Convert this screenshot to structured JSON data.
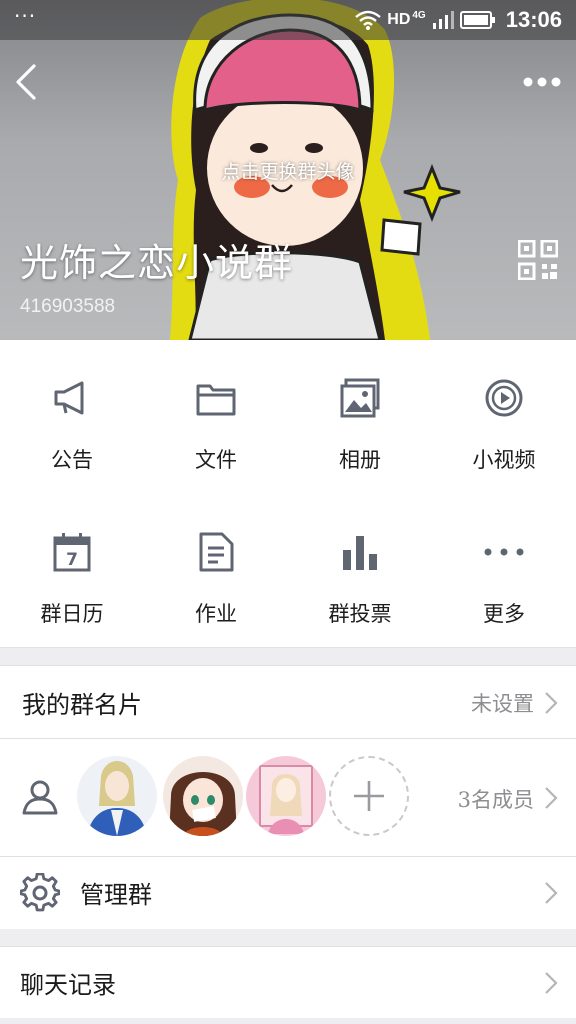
{
  "status_bar": {
    "left_dots": "···",
    "network": "HD",
    "net_gen": "4G",
    "time": "13:06"
  },
  "header": {
    "change_avatar_hint": "点击更换群头像",
    "group_name": "光饰之恋小说群",
    "group_id": "416903588"
  },
  "features": [
    {
      "label": "公告",
      "icon": "megaphone-icon"
    },
    {
      "label": "文件",
      "icon": "folder-icon"
    },
    {
      "label": "相册",
      "icon": "photo-album-icon"
    },
    {
      "label": "小视频",
      "icon": "video-play-icon"
    },
    {
      "label": "群日历",
      "icon": "calendar-icon",
      "icon_text": "7"
    },
    {
      "label": "作业",
      "icon": "document-icon"
    },
    {
      "label": "群投票",
      "icon": "bar-chart-icon"
    },
    {
      "label": "更多",
      "icon": "more-icon"
    }
  ],
  "my_card": {
    "label": "我的群名片",
    "value": "未设置"
  },
  "members": {
    "count_label": "3名成员"
  },
  "manage": {
    "label": "管理群"
  },
  "chat_history": {
    "label": "聊天记录"
  },
  "colors": {
    "icon_gray": "#5f6672",
    "accent_yellow": "#e6e000",
    "hat_pink": "#e3608a"
  }
}
